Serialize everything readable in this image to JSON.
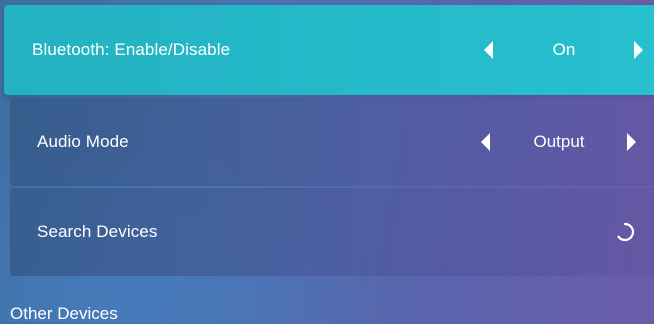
{
  "settings": {
    "bluetooth": {
      "label": "Bluetooth: Enable/Disable",
      "value": "On"
    },
    "audio_mode": {
      "label": "Audio Mode",
      "value": "Output"
    },
    "search_devices": {
      "label": "Search Devices"
    }
  },
  "sections": {
    "other_devices": "Other Devices"
  },
  "colors": {
    "selected_row": "#27c0cf",
    "text": "#ffffff"
  },
  "icons": {
    "prev": "chevron-left-icon",
    "next": "chevron-right-icon",
    "loading": "loading-spinner-icon"
  }
}
